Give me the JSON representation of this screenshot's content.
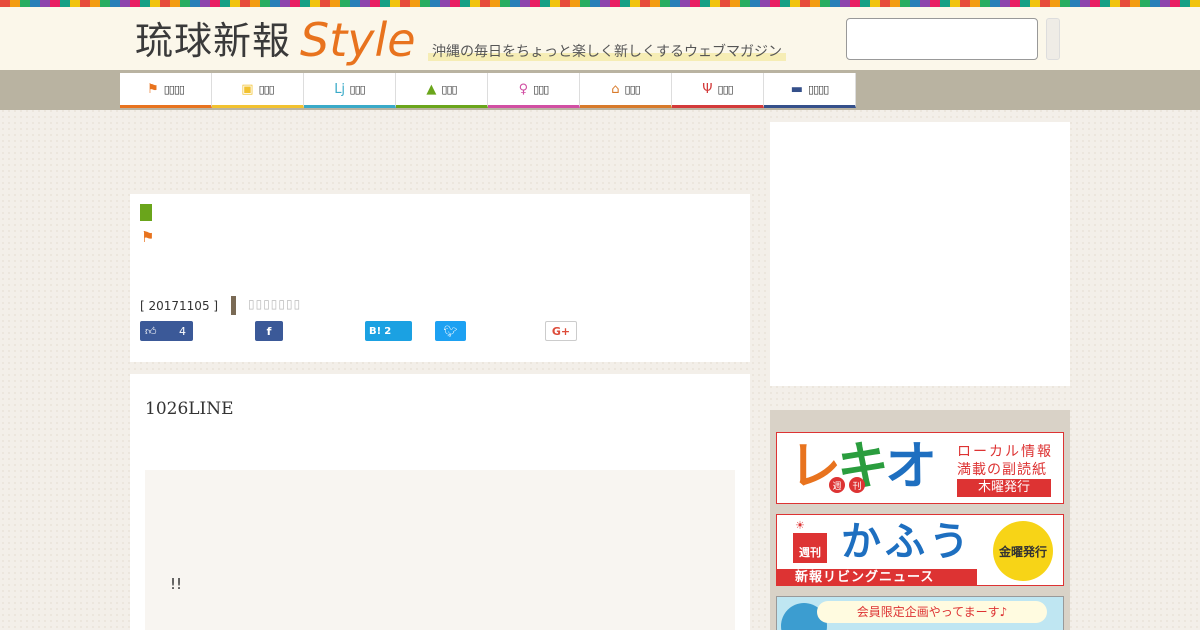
{
  "header": {
    "logo_jp": "琉球新報",
    "logo_en": "Style",
    "tagline": "沖縄の毎日をちょっと楽しく新しくするウェブマガジン",
    "search_placeholder": ""
  },
  "nav": {
    "items": [
      {
        "icon": "flag-icon",
        "label": "▯▯▯▯",
        "color": "#e8731e"
      },
      {
        "icon": "gift-icon",
        "label": "▯▯▯",
        "color": "#f2c230"
      },
      {
        "icon": "people-icon",
        "label": "▯▯▯",
        "color": "#3aaac8"
      },
      {
        "icon": "graduation-cap-icon",
        "label": "▯▯▯",
        "color": "#6aa51b"
      },
      {
        "icon": "dancer-icon",
        "label": "▯▯▯",
        "color": "#d14fa3"
      },
      {
        "icon": "house-icon",
        "label": "▯▯▯",
        "color": "#d87a2a"
      },
      {
        "icon": "utensils-icon",
        "label": "▯▯▯",
        "color": "#d33a3a"
      },
      {
        "icon": "briefcase-icon",
        "label": "▯▯▯▯",
        "color": "#35508a"
      }
    ]
  },
  "article": {
    "date": "[ 20171105 ]",
    "author": "▯▯▯▯▯▯▯",
    "share": {
      "like_count": "4",
      "hatena_label": "B!",
      "hatena_count": "2",
      "gplus_label": "G+"
    },
    "lead": "1026LINE",
    "inner_text": "!!"
  },
  "sidebar": {
    "banners": {
      "rekio": {
        "logo_1": "レ",
        "logo_2": "キ",
        "logo_3": "オ",
        "badge_1": "週",
        "badge_2": "刊",
        "line1": "ローカル情報",
        "line2": "満載の副読紙",
        "day": "木曜発行"
      },
      "kafuu": {
        "house_label": "週刊",
        "logo": "かふう",
        "day": "金曜発行",
        "sub": "新報リビングニュース"
      },
      "third": {
        "bubble": "会員限定企画やってまーす♪"
      }
    }
  }
}
